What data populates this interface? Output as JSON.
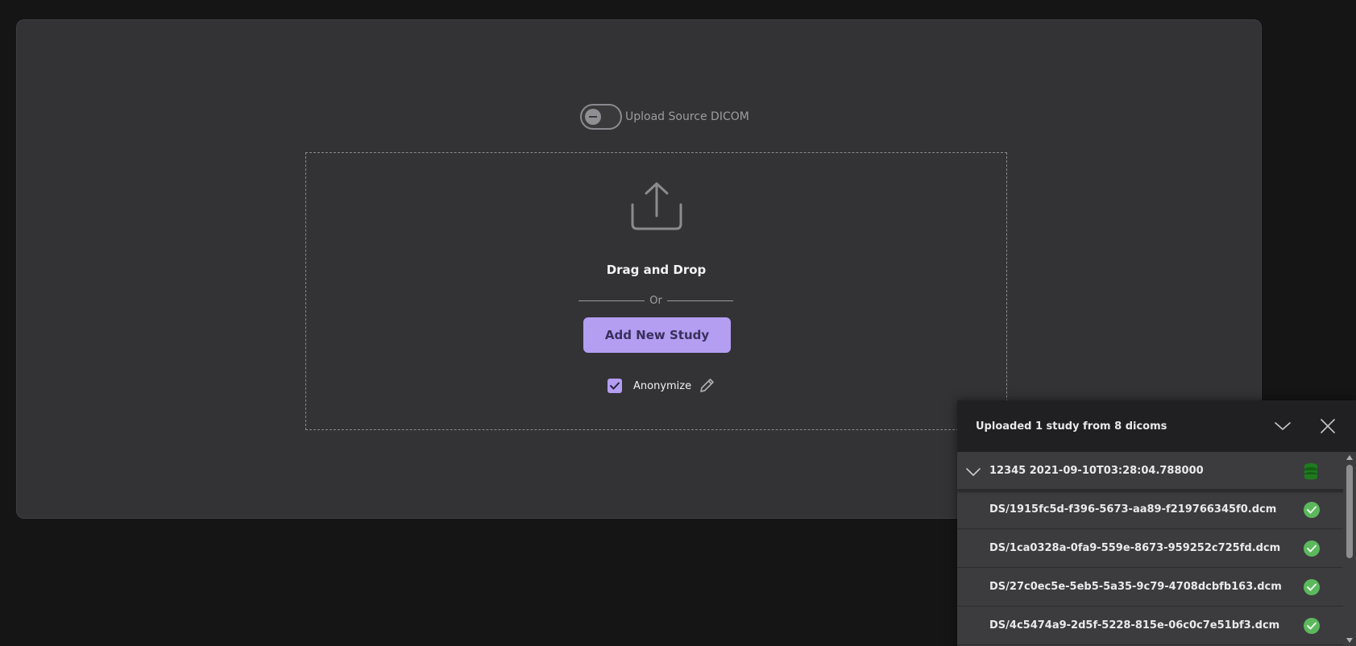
{
  "upload_source": {
    "label": "Upload Source DICOM",
    "enabled": false
  },
  "dropzone": {
    "title": "Drag and Drop",
    "or_text": "Or",
    "add_button": "Add New Study",
    "anonymize_label": "Anonymize",
    "anonymize_checked": true
  },
  "icons": {
    "upload": "upload-tray-icon",
    "pencil": "pencil-icon",
    "collapse": "chevron-down-icon",
    "close": "close-icon",
    "database": "database-icon",
    "success": "check-circle-icon"
  },
  "panel": {
    "title": "Uploaded 1 study from 8 dicoms",
    "study": {
      "label": "12345 2021-09-10T03:28:04.788000"
    },
    "files": [
      {
        "name": "DS/1915fc5d-f396-5673-aa89-f219766345f0.dcm"
      },
      {
        "name": "DS/1ca0328a-0fa9-559e-8673-959252c725fd.dcm"
      },
      {
        "name": "DS/27c0ec5e-5eb5-5a35-9c79-4708dcbfb163.dcm"
      },
      {
        "name": "DS/4c5474a9-2d5f-5228-815e-06c0c7e51bf3.dcm"
      }
    ]
  },
  "colors": {
    "accent": "#b39ef2",
    "background": "#151515",
    "card": "#333336",
    "panel": "#3c3c3f",
    "panel_header": "#202023",
    "success": "#4caf50",
    "database": "#1f7a1f"
  }
}
